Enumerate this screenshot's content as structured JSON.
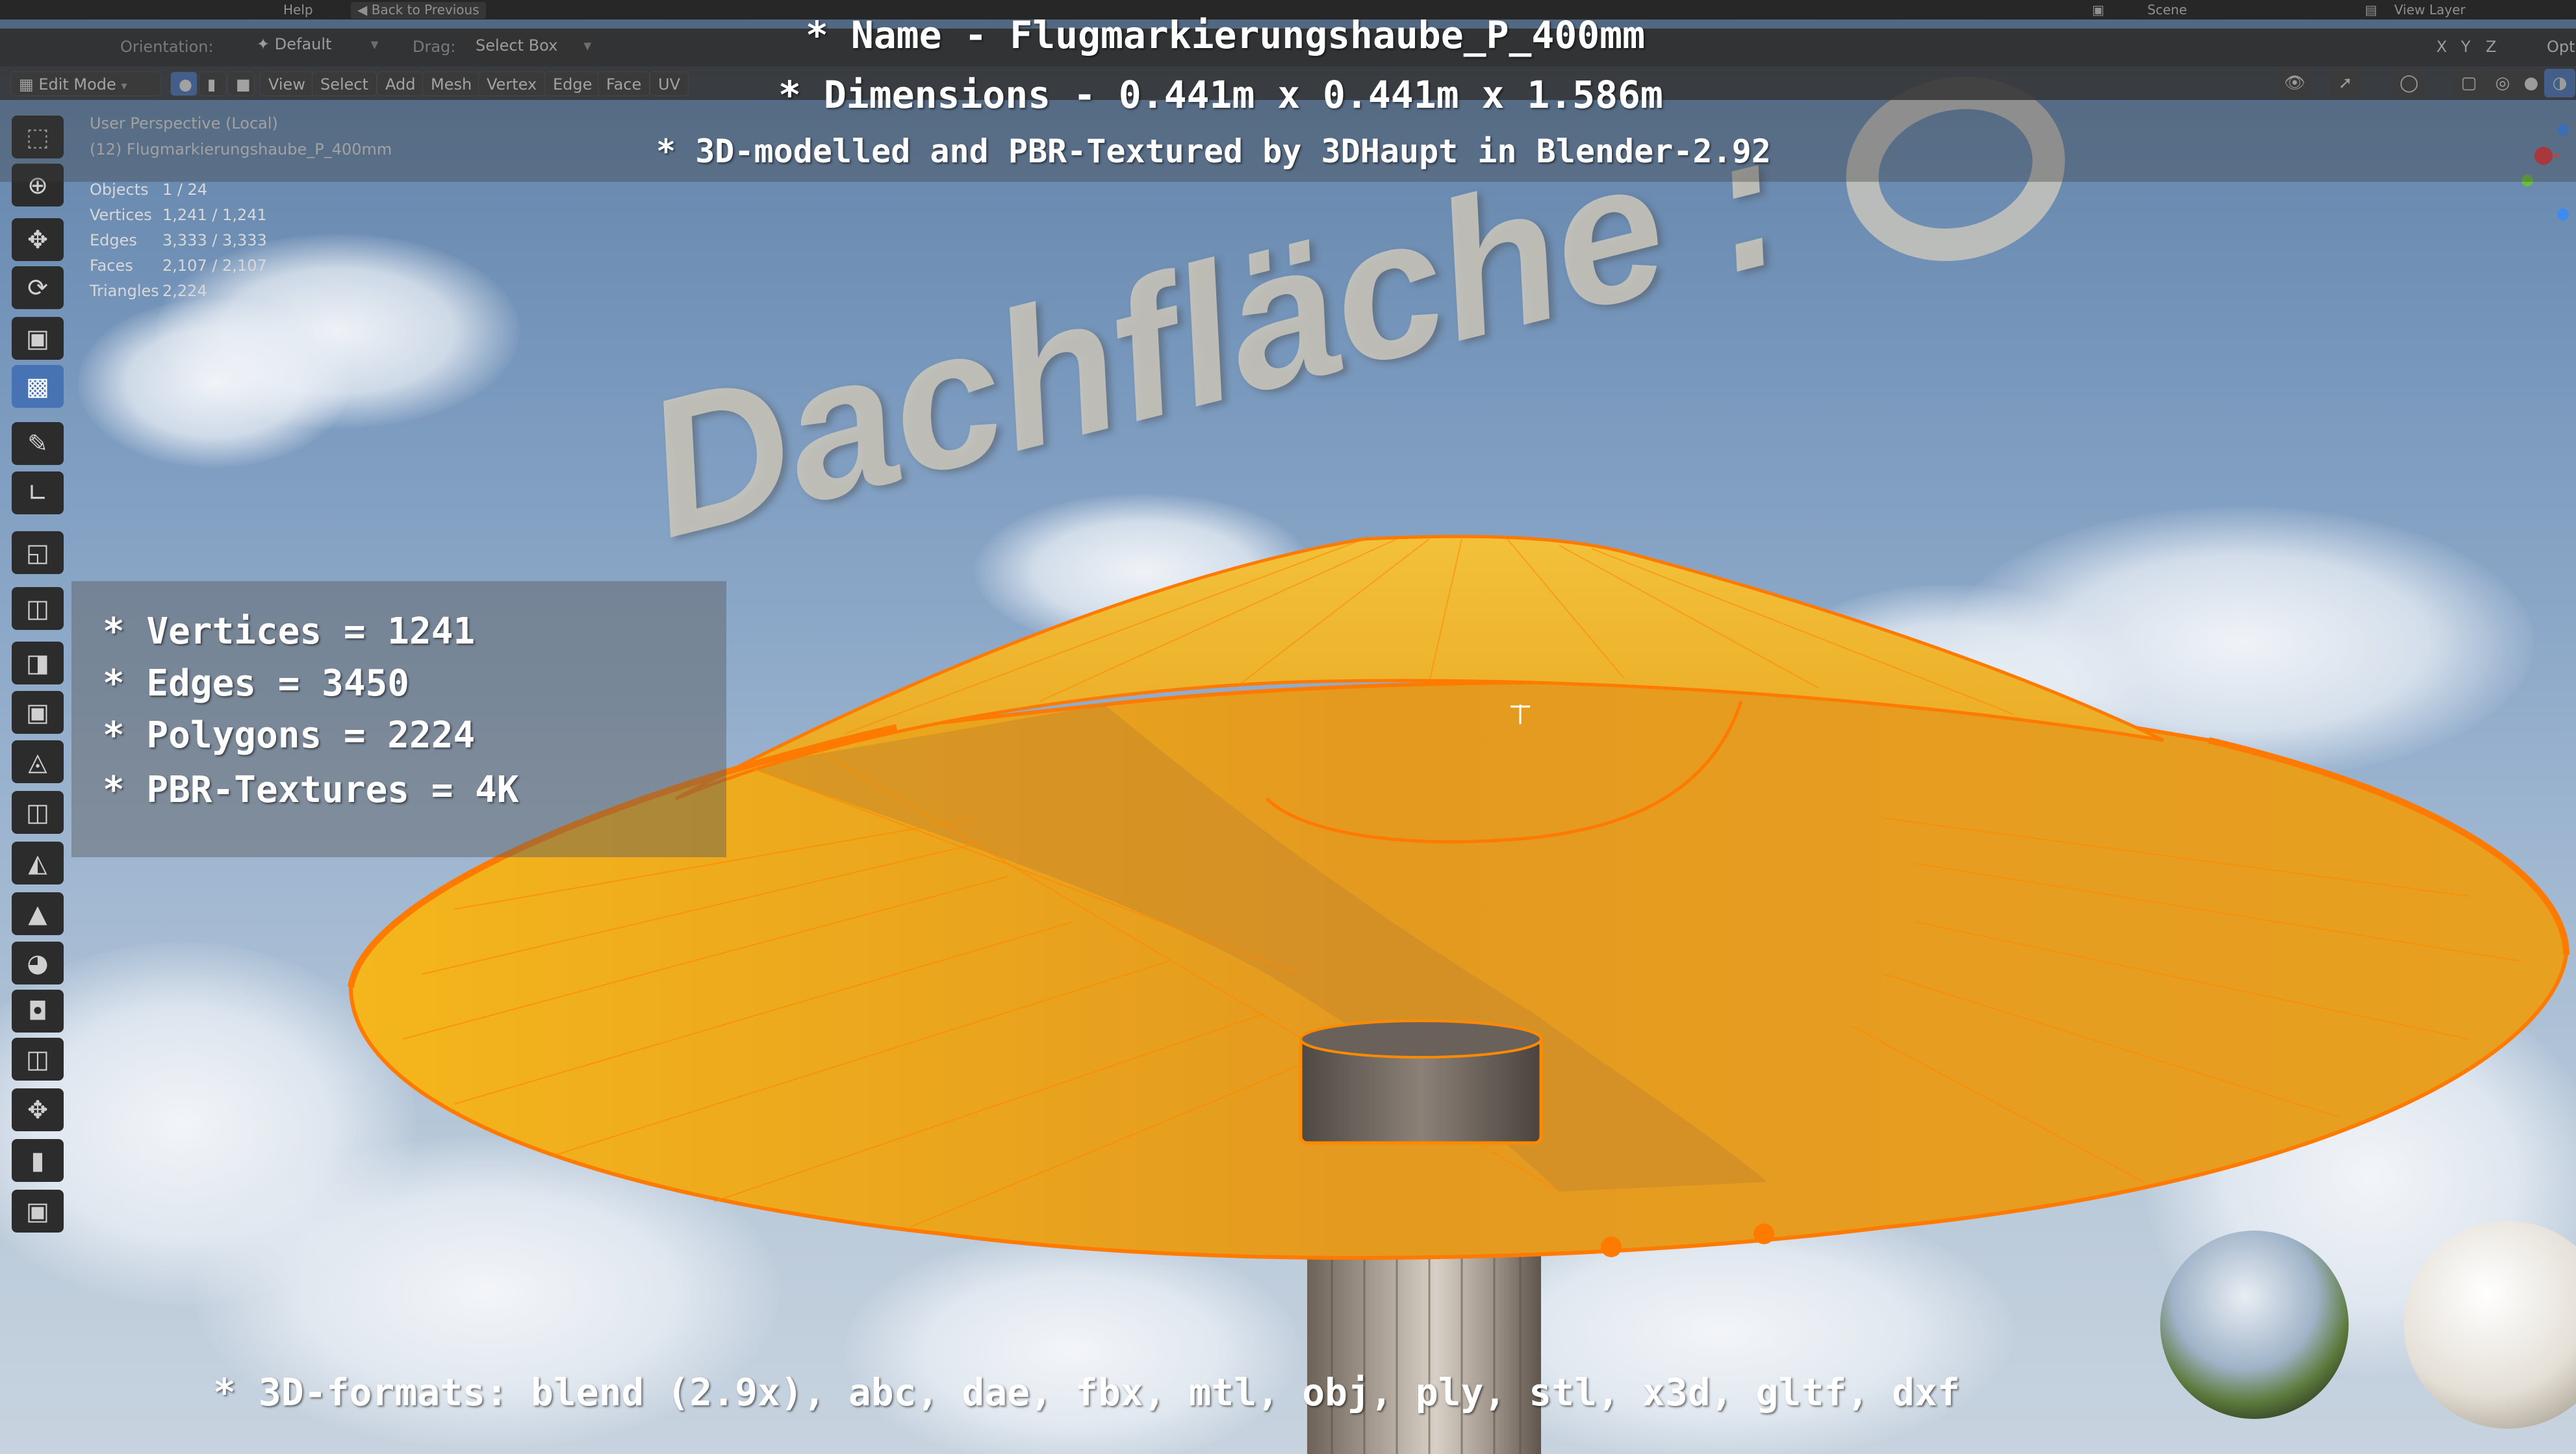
{
  "app": {
    "menu": [
      "Help"
    ],
    "back_button": "Back to Previous",
    "scene_label": "Scene",
    "view_layer_label": "View Layer",
    "options_label": "Opti",
    "orientation_label": "Orientation:",
    "orientation_value": "Default",
    "drag_label": "Drag:",
    "drag_value": "Select Box",
    "xyz": [
      "X",
      "Y",
      "Z"
    ]
  },
  "header": {
    "mode": "Edit Mode",
    "menus": [
      "View",
      "Select",
      "Add",
      "Mesh",
      "Vertex",
      "Edge",
      "Face",
      "UV"
    ]
  },
  "viewport": {
    "perspective": "User Perspective (Local)",
    "object_name": "(12) Flugmarkierungshaube_P_400mm",
    "stats": [
      {
        "label": "Objects",
        "value": "1 / 24"
      },
      {
        "label": "Vertices",
        "value": "1,241 / 1,241"
      },
      {
        "label": "Edges",
        "value": "3,333 / 3,333"
      },
      {
        "label": "Faces",
        "value": "2,107 / 2,107"
      },
      {
        "label": "Triangles",
        "value": "2,224"
      }
    ],
    "background_text": "Dachfläche :"
  },
  "overlay": {
    "title_line1": "* Name - Flugmarkierungshaube_P_400mm",
    "title_line2": "* Dimensions -  0.441m x 0.441m x 1.586m",
    "title_line3": "* 3D-modelled and PBR-Textured by 3DHaupt in Blender-2.92",
    "specs": [
      "* Vertices = 1241",
      "* Edges = 3450",
      "* Polygons = 2224",
      "* PBR-Textures = 4K"
    ],
    "formats": "* 3D-formats: blend (2.9x), abc, dae, fbx, mtl, obj, ply, stl, x3d, gltf, dxf"
  },
  "colors": {
    "sky_top": "#5d7ea6",
    "sky_bottom": "#c7d3df",
    "hat_yellow": "#f2b118",
    "hat_orange": "#e7821f",
    "edge_orange": "#ff8a00",
    "active_tool": "#4772b3"
  },
  "icons": {
    "left_tools": [
      "select-box-icon",
      "cursor-icon",
      "move-icon",
      "rotate-icon",
      "scale-icon",
      "transform-icon",
      "annotate-icon",
      "measure-icon",
      "add-cube-icon",
      "extrude-icon",
      "inset-icon",
      "bevel-icon",
      "loop-cut-icon",
      "knife-icon",
      "poly-build-icon",
      "spin-icon",
      "smooth-icon",
      "edge-slide-icon",
      "shrink-fatten-icon",
      "shear-icon",
      "rip-icon"
    ]
  }
}
